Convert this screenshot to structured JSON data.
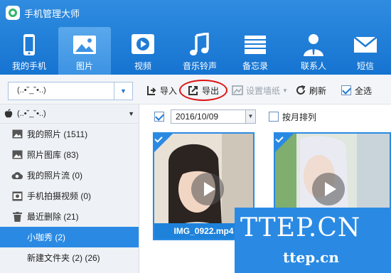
{
  "app": {
    "title": "手机管理大师"
  },
  "nav": [
    {
      "label": "我的手机",
      "icon": "phone-icon"
    },
    {
      "label": "图片",
      "icon": "picture-icon",
      "active": true
    },
    {
      "label": "视频",
      "icon": "video-icon"
    },
    {
      "label": "音乐铃声",
      "icon": "music-icon"
    },
    {
      "label": "备忘录",
      "icon": "memo-icon"
    },
    {
      "label": "联系人",
      "icon": "contact-icon"
    },
    {
      "label": "短信",
      "icon": "sms-icon"
    }
  ],
  "toolbar": {
    "device_name": "(..•˘_˘•..)",
    "import_label": "导入",
    "export_label": "导出",
    "wallpaper_label": "设置墙纸",
    "refresh_label": "刷新",
    "select_all_label": "全选"
  },
  "sidebar": {
    "device_name": "(..•˘_˘•..)",
    "items": [
      {
        "label": "我的照片 (1511)",
        "icon": "photos-icon"
      },
      {
        "label": "照片图库 (83)",
        "icon": "gallery-icon"
      },
      {
        "label": "我的照片流 (0)",
        "icon": "photo-stream-icon"
      },
      {
        "label": "手机拍摄视频 (0)",
        "icon": "camera-video-icon"
      },
      {
        "label": "最近删除 (21)",
        "icon": "trash-icon"
      },
      {
        "label": "小咖秀 (2)",
        "active": true
      },
      {
        "label": "新建文件夹 (2) (26)"
      }
    ]
  },
  "filter": {
    "date_checked": true,
    "date": "2016/10/09",
    "sort_by_month_label": "按月排列",
    "sort_by_month_checked": false
  },
  "thumbnails": [
    {
      "caption": "IMG_0922.mp4",
      "selected": true
    },
    {
      "caption": "",
      "selected": true
    }
  ],
  "watermark": {
    "big": "TTEP.CN",
    "small": "ttep.cn"
  },
  "colors": {
    "header": "#1674d1",
    "accent": "#2a8ae3",
    "highlight": "#dd1111"
  }
}
